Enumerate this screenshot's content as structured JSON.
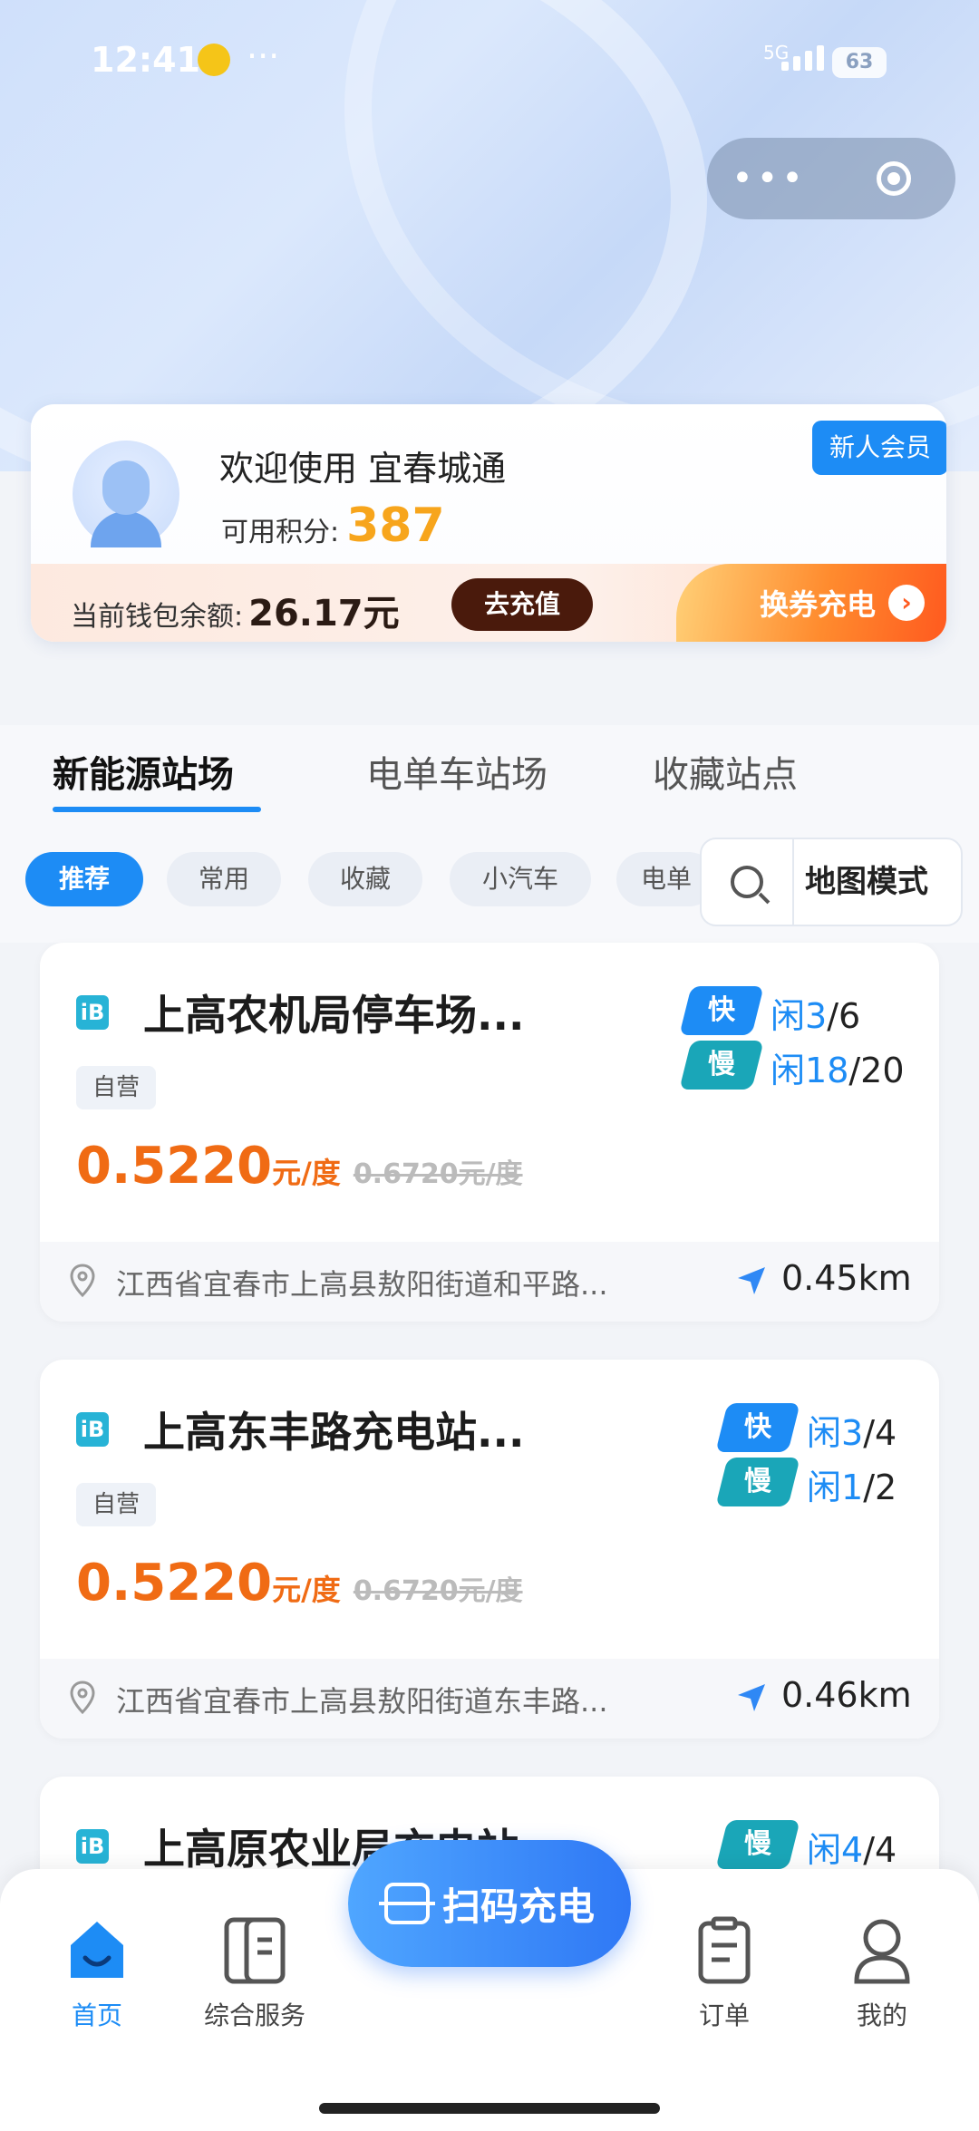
{
  "status": {
    "time": "12:41",
    "dots": "···",
    "network": "5G",
    "battery": "63"
  },
  "capsule": {
    "more": "•••",
    "icons": [
      "more-icon",
      "target-icon"
    ]
  },
  "member": {
    "welcome": "欢迎使用 宜春城通",
    "points_label": "可用积分:",
    "points_value": "387",
    "new_member": "新人会员",
    "wallet_label": "当前钱包余额:",
    "wallet_amount": "26.17元",
    "recharge": "去充值",
    "exchange": "换券充电"
  },
  "tabs": [
    "新能源站场",
    "电单车站场",
    "收藏站点"
  ],
  "chips": [
    "推荐",
    "常用",
    "收藏",
    "小汽车",
    "电单"
  ],
  "map": {
    "label": "地图模式"
  },
  "stations": [
    {
      "name": "上高农机局停车场...",
      "tag": "自营",
      "price": "0.5220",
      "unit": "元/度",
      "old_price": "0.6720元/度",
      "fast": {
        "label": "快",
        "free_prefix": "闲",
        "free": "3",
        "total": "/6"
      },
      "slow": {
        "label": "慢",
        "free_prefix": "闲",
        "free": "18",
        "total": "/20"
      },
      "address": "江西省宜春市上高县敖阳街道和平路...",
      "distance": "0.45km"
    },
    {
      "name": "上高东丰路充电站...",
      "tag": "自营",
      "price": "0.5220",
      "unit": "元/度",
      "old_price": "0.6720元/度",
      "fast": {
        "label": "快",
        "free_prefix": "闲",
        "free": "3",
        "total": "/4"
      },
      "slow": {
        "label": "慢",
        "free_prefix": "闲",
        "free": "1",
        "total": "/2"
      },
      "address": "江西省宜春市上高县敖阳街道东丰路...",
      "distance": "0.46km"
    },
    {
      "name": "上高原农业局充电站",
      "slow": {
        "label": "慢",
        "free_prefix": "闲",
        "free": "4",
        "total": "/4"
      }
    }
  ],
  "bottom_nav": {
    "home": "首页",
    "services": "综合服务",
    "scan": "扫码充电",
    "orders": "订单",
    "mine": "我的"
  },
  "colors": {
    "accent": "#1d8cf5",
    "price": "#f06b14",
    "slow_badge": "#1aa6b8"
  }
}
